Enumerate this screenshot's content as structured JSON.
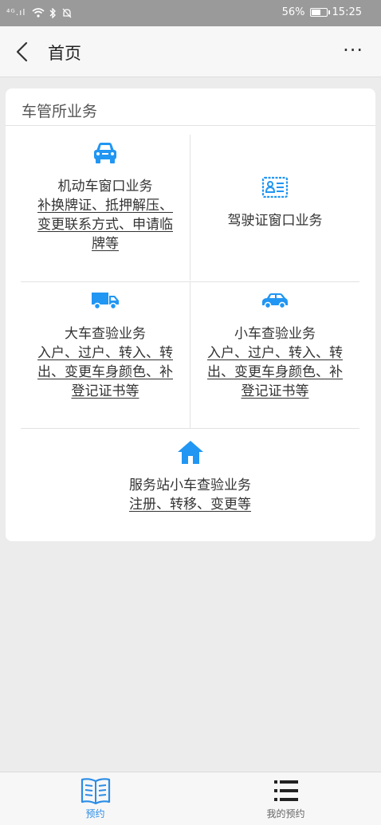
{
  "status_bar": {
    "signal_text": "⁴ᴳ.ıl",
    "battery": "56%",
    "battery_level": 0.56,
    "time": "15:25"
  },
  "nav": {
    "title": "首页",
    "more": "···"
  },
  "section": {
    "title": "车管所业务"
  },
  "services": [
    {
      "title": "机动车窗口业务",
      "sub": [
        "补换牌证、抵押解压、",
        "变更联系方式、申请临",
        "牌等"
      ],
      "icon": "car-front-icon"
    },
    {
      "title": "驾驶证窗口业务",
      "sub": [],
      "icon": "license-card-icon"
    },
    {
      "title": "大车查验业务",
      "sub": [
        "入户、过户、转入、转",
        "出、变更车身颜色、补",
        "登记证书等"
      ],
      "icon": "truck-icon"
    },
    {
      "title": "小车查验业务",
      "sub": [
        "入户、过户、转入、转",
        "出、变更车身颜色、补",
        "登记证书等"
      ],
      "icon": "car-side-icon"
    },
    {
      "title": "服务站小车查验业务",
      "sub": [
        "注册、转移、变更等"
      ],
      "icon": "house-icon"
    }
  ],
  "tabs": [
    {
      "label": "预约",
      "icon": "book-icon",
      "active": true
    },
    {
      "label": "我的预约",
      "icon": "list-icon",
      "active": false
    }
  ],
  "colors": {
    "accent": "#2196f3",
    "tab_active": "#2b8de6"
  }
}
